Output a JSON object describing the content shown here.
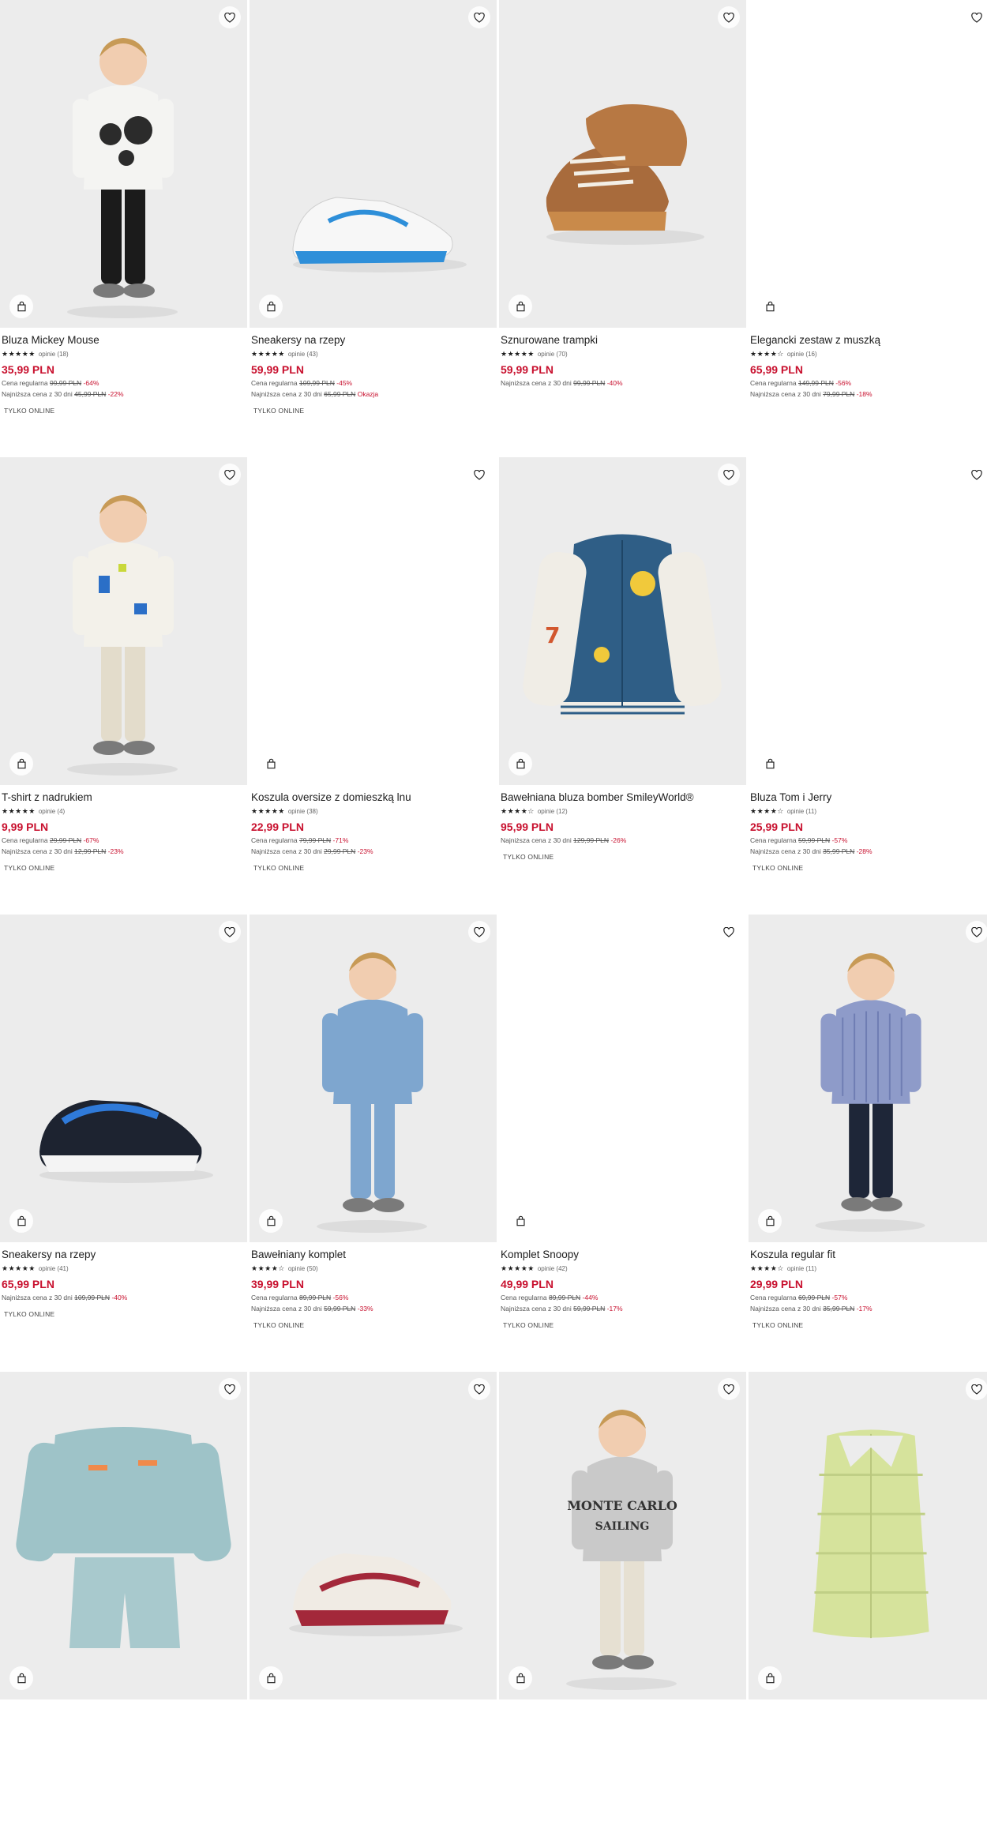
{
  "labels": {
    "regular": "Cena regularna",
    "lowest": "Najniższa cena z 30 dni",
    "online": "TYLKO ONLINE"
  },
  "colors": {
    "price": "#c8102e",
    "photo_bg": "#ececec"
  },
  "products": [
    {
      "name": "Bluza Mickey Mouse",
      "stars": "★★★★★",
      "reviews": "opinie (18)",
      "price": "35,99 PLN",
      "regular_old": "99,99 PLN",
      "regular_pct": "-64%",
      "lowest_old": "45,99 PLN",
      "lowest_pct": "-22%",
      "online": true,
      "image": "boy-mickey-hoodie"
    },
    {
      "name": "Sneakersy na rzepy",
      "stars": "★★★★★",
      "reviews": "opinie (43)",
      "price": "59,99 PLN",
      "regular_old": "109,99 PLN",
      "regular_pct": "-45%",
      "lowest_old": "65,99 PLN",
      "lowest_pct": "Okazja",
      "online": true,
      "image": "white-blue-sneaker"
    },
    {
      "name": "Sznurowane trampki",
      "stars": "★★★★★",
      "reviews": "opinie (70)",
      "price": "59,99 PLN",
      "lowest_old": "99,99 PLN",
      "lowest_pct": "-40%",
      "online": false,
      "image": "brown-sneakers"
    },
    {
      "name": "Elegancki zestaw z muszką",
      "stars": "★★★★☆",
      "reviews": "opinie (16)",
      "price": "65,99 PLN",
      "regular_old": "149,99 PLN",
      "regular_pct": "-56%",
      "lowest_old": "79,99 PLN",
      "lowest_pct": "-18%",
      "online": false,
      "image": "none"
    },
    {
      "name": "T-shirt z nadrukiem",
      "stars": "★★★★★",
      "reviews": "opinie (4)",
      "price": "9,99 PLN",
      "regular_old": "29,99 PLN",
      "regular_pct": "-67%",
      "lowest_old": "12,99 PLN",
      "lowest_pct": "-23%",
      "online": true,
      "image": "boy-tshirt"
    },
    {
      "name": "Koszula oversize z domieszką lnu",
      "stars": "★★★★★",
      "reviews": "opinie (38)",
      "price": "22,99 PLN",
      "regular_old": "79,99 PLN",
      "regular_pct": "-71%",
      "lowest_old": "29,99 PLN",
      "lowest_pct": "-23%",
      "online": true,
      "image": "none"
    },
    {
      "name": "Bawełniana bluza bomber SmileyWorld®",
      "stars": "★★★★☆",
      "reviews": "opinie (12)",
      "price": "95,99 PLN",
      "lowest_old": "129,99 PLN",
      "lowest_pct": "-26%",
      "online": true,
      "image": "bomber-jacket"
    },
    {
      "name": "Bluza Tom i Jerry",
      "stars": "★★★★☆",
      "reviews": "opinie (11)",
      "price": "25,99 PLN",
      "regular_old": "59,99 PLN",
      "regular_pct": "-57%",
      "lowest_old": "35,99 PLN",
      "lowest_pct": "-28%",
      "online": true,
      "image": "none"
    },
    {
      "name": "Sneakersy na rzepy",
      "stars": "★★★★★",
      "reviews": "opinie (41)",
      "price": "65,99 PLN",
      "lowest_old": "109,99 PLN",
      "lowest_pct": "-40%",
      "online": true,
      "image": "black-blue-sneaker"
    },
    {
      "name": "Bawełniany komplet",
      "stars": "★★★★☆",
      "reviews": "opinie (50)",
      "price": "39,99 PLN",
      "regular_old": "89,99 PLN",
      "regular_pct": "-56%",
      "lowest_old": "59,99 PLN",
      "lowest_pct": "-33%",
      "online": true,
      "image": "boy-blue-set"
    },
    {
      "name": "Komplet Snoopy",
      "stars": "★★★★★",
      "reviews": "opinie (42)",
      "price": "49,99 PLN",
      "regular_old": "89,99 PLN",
      "regular_pct": "-44%",
      "lowest_old": "59,99 PLN",
      "lowest_pct": "-17%",
      "online": true,
      "image": "none"
    },
    {
      "name": "Koszula regular fit",
      "stars": "★★★★☆",
      "reviews": "opinie (11)",
      "price": "29,99 PLN",
      "regular_old": "69,99 PLN",
      "regular_pct": "-57%",
      "lowest_old": "35,99 PLN",
      "lowest_pct": "-17%",
      "online": true,
      "image": "boy-striped-shirt"
    },
    {
      "name": "",
      "stars": "",
      "reviews": "",
      "price": "",
      "online": false,
      "image": "teal-sweat-set"
    },
    {
      "name": "",
      "stars": "",
      "reviews": "",
      "price": "",
      "online": false,
      "image": "white-red-sneaker"
    },
    {
      "name": "",
      "stars": "",
      "reviews": "",
      "price": "",
      "online": false,
      "image": "boy-monte-carlo"
    },
    {
      "name": "",
      "stars": "",
      "reviews": "",
      "price": "",
      "online": false,
      "image": "green-vest"
    }
  ],
  "art_text": {
    "monte_carlo": "MONTE CARLO",
    "sailing": "SAILING",
    "bomber_number": "7"
  }
}
